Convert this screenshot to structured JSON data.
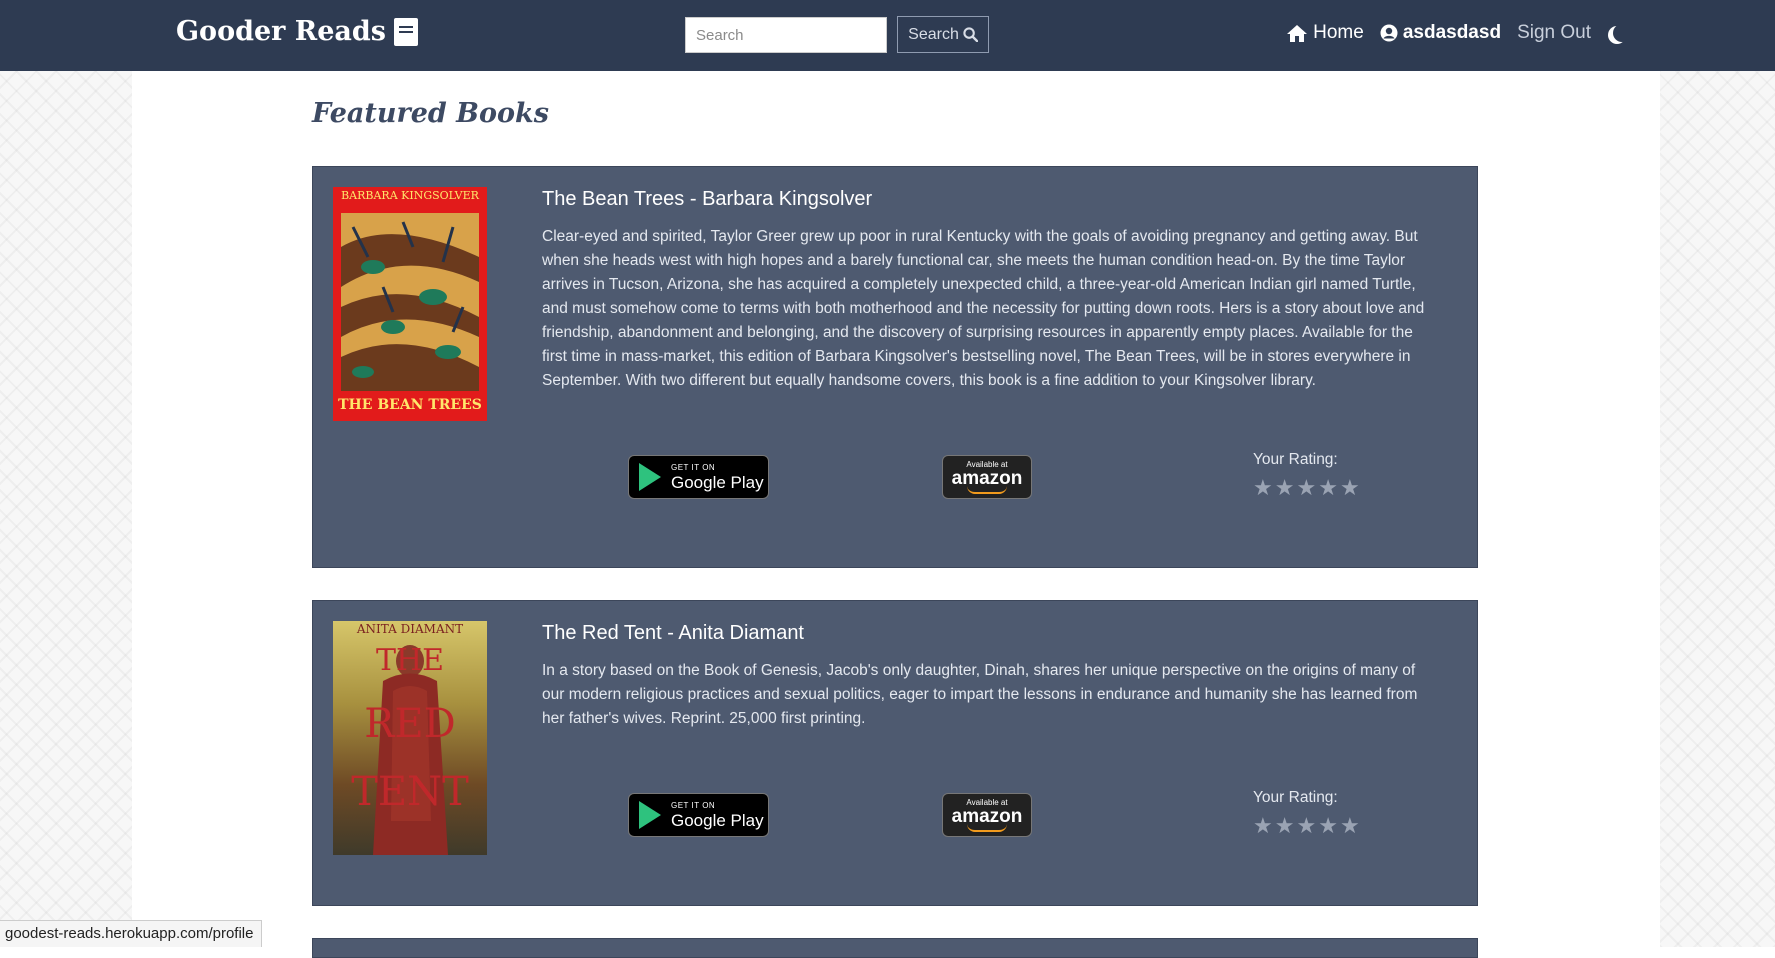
{
  "nav": {
    "brand": "Gooder Reads",
    "search_placeholder": "Search",
    "search_button": "Search",
    "home": "Home",
    "username": "asdasdasd",
    "sign_out": "Sign Out"
  },
  "main": {
    "section_title": "Featured Books",
    "books": [
      {
        "title": "The Bean Trees - Barbara Kingsolver",
        "description": "Clear-eyed and spirited, Taylor Greer grew up poor in rural Kentucky with the goals of avoiding pregnancy and getting away. But when she heads west with high hopes and a barely functional car, she meets the human condition head-on. By the time Taylor arrives in Tucson, Arizona, she has acquired a completely unexpected child, a three-year-old American Indian girl named Turtle, and must somehow come to terms with both motherhood and the necessity for putting down roots. Hers is a story about love and friendship, abandonment and belonging, and the discovery of surprising resources in apparently empty places. Available for the first time in mass-market, this edition of Barbara Kingsolver's bestselling novel, The Bean Trees, will be in stores everywhere in September. With two different but equally handsome covers, this book is a fine addition to your Kingsolver library.",
        "cover_author": "BARBARA KINGSOLVER",
        "cover_title": "THE BEAN TREES",
        "rating_label": "Your Rating:"
      },
      {
        "title": "The Red Tent - Anita Diamant",
        "description": "In a story based on the Book of Genesis, Jacob's only daughter, Dinah, shares her unique perspective on the origins of many of our modern religious practices and sexual politics, eager to impart the lessons in endurance and humanity she has learned from her father's wives. Reprint. 25,000 first printing.",
        "cover_author": "ANITA DIAMANT",
        "cover_title_1": "THE",
        "cover_title_2": "RED",
        "cover_title_3": "TENT",
        "rating_label": "Your Rating:"
      }
    ]
  },
  "stores": {
    "google_small": "GET IT ON",
    "google_big": "Google Play",
    "amazon_small": "Available at",
    "amazon_big": "amazon"
  },
  "status_bar": {
    "url": "goodest-reads.herokuapp.com/profile"
  },
  "colors": {
    "navbar": "#2e3b52",
    "card": "#4e5a70",
    "title": "#3d4a63"
  },
  "icons": [
    "book-icon",
    "search-icon",
    "home-icon",
    "user-circle-icon",
    "moon-icon",
    "star-icon"
  ]
}
